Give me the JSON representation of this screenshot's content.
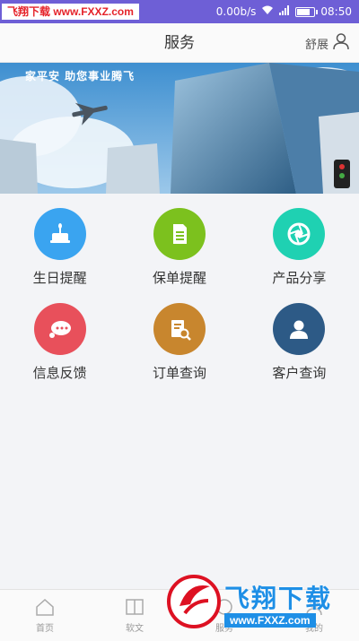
{
  "status_bar": {
    "watermark": "飞翔下载 www.FXXZ.com",
    "network_speed": "0.00b/s",
    "time": "08:50",
    "accent": "#6e5fd6"
  },
  "header": {
    "title": "服务",
    "user_name": "舒展"
  },
  "banner": {
    "caption": "家平安 助您事业腾飞"
  },
  "services": [
    {
      "label": "生日提醒",
      "color": "#3aa4f0",
      "icon": "birthday-cake-icon"
    },
    {
      "label": "保单提醒",
      "color": "#7cc11e",
      "icon": "document-icon"
    },
    {
      "label": "产品分享",
      "color": "#1fd1b2",
      "icon": "aperture-icon"
    },
    {
      "label": "信息反馈",
      "color": "#e8505b",
      "icon": "chat-bubble-icon"
    },
    {
      "label": "订单查询",
      "color": "#c8862e",
      "icon": "order-search-icon"
    },
    {
      "label": "客户查询",
      "color": "#2d5a86",
      "icon": "user-icon"
    }
  ],
  "bottom_nav": [
    {
      "label": "首页",
      "icon": "home-icon"
    },
    {
      "label": "软文",
      "icon": "book-icon"
    },
    {
      "label": "服务",
      "icon": "service-icon"
    },
    {
      "label": "我的",
      "icon": "profile-icon"
    }
  ],
  "watermark_bottom": {
    "text": "飞翔下载",
    "url": "www.FXXZ.com"
  }
}
